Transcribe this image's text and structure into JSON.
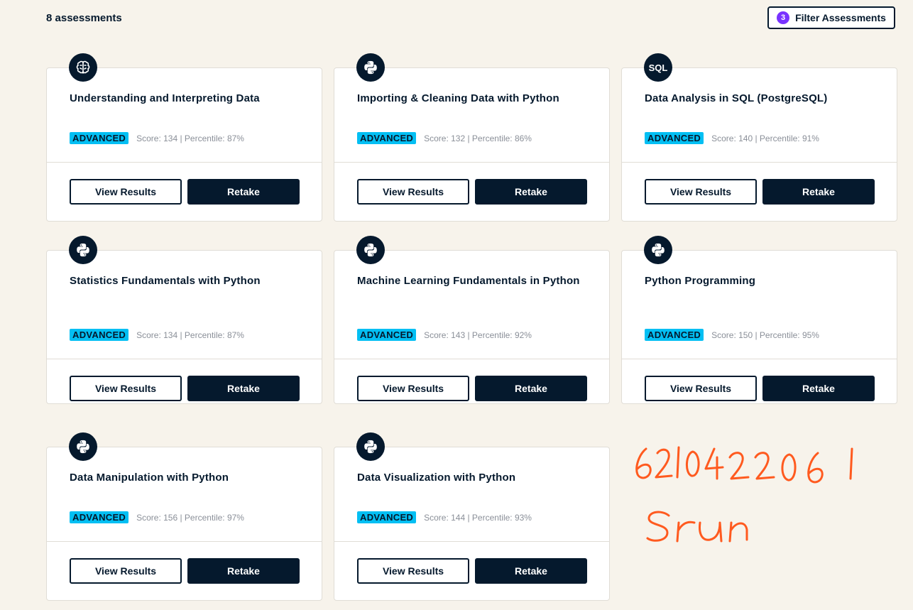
{
  "header": {
    "count_label": "8 assessments",
    "filter_label": "Filter Assessments",
    "filter_count": "3"
  },
  "button_labels": {
    "view": "View Results",
    "retake": "Retake"
  },
  "cards": [
    {
      "icon": "brain-icon",
      "title": "Understanding and Interpreting Data",
      "level": "ADVANCED",
      "score": "Score: 134 | Percentile: 87%"
    },
    {
      "icon": "python-icon",
      "title": "Importing & Cleaning Data with Python",
      "level": "ADVANCED",
      "score": "Score: 132 | Percentile: 86%"
    },
    {
      "icon": "sql-icon",
      "icon_text": "SQL",
      "title": "Data Analysis in SQL (PostgreSQL)",
      "level": "ADVANCED",
      "score": "Score: 140 | Percentile: 91%"
    },
    {
      "icon": "python-icon",
      "title": "Statistics Fundamentals with Python",
      "level": "ADVANCED",
      "score": "Score: 134 | Percentile: 87%"
    },
    {
      "icon": "python-icon",
      "title": "Machine Learning Fundamentals in Python",
      "level": "ADVANCED",
      "score": "Score: 143 | Percentile: 92%"
    },
    {
      "icon": "python-icon",
      "title": "Python Programming",
      "level": "ADVANCED",
      "score": "Score: 150 | Percentile: 95%"
    },
    {
      "icon": "python-icon",
      "title": "Data Manipulation with Python",
      "level": "ADVANCED",
      "score": "Score: 156 | Percentile: 97%"
    },
    {
      "icon": "python-icon",
      "title": "Data Visualization with Python",
      "level": "ADVANCED",
      "score": "Score: 144 | Percentile: 93%"
    }
  ],
  "annotation": {
    "number": "6210422061",
    "name": "Srun",
    "color": "#ff5a1f"
  },
  "colors": {
    "accent": "#05192d",
    "badge": "#03bff3",
    "filter_count": "#7933ff"
  }
}
